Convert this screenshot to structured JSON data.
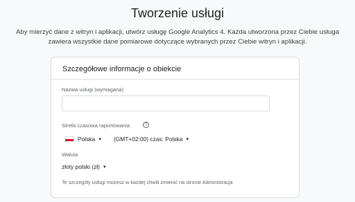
{
  "page": {
    "title": "Tworzenie usługi",
    "subtitle": "Aby mierzyć dane z witryn i aplikacji, utwórz usługę Google Analytics 4. Każda utworzona przez Ciebie usługa zawiera wszystkie dane pomiarowe dotyczące wybranych przez Ciebie witryn i aplikacji."
  },
  "card": {
    "title": "Szczegółowe informacje o obiekcie",
    "property_name": {
      "label": "Nazwa usługi (wymagana)",
      "value": ""
    },
    "timezone": {
      "label": "Strefa czasowa raportowania",
      "help_icon": "help-circle-icon",
      "country": "Polska",
      "zone": "(GMT+02:00) czas: Polska"
    },
    "currency": {
      "label": "Waluta",
      "value": "złoty polski (zł)"
    },
    "footnote": "Te szczegóły usługi możesz w każdej chwili zmienić na stronie Administracja"
  },
  "colors": {
    "flag_red": "#dc143c",
    "card_border": "#dadce0"
  }
}
